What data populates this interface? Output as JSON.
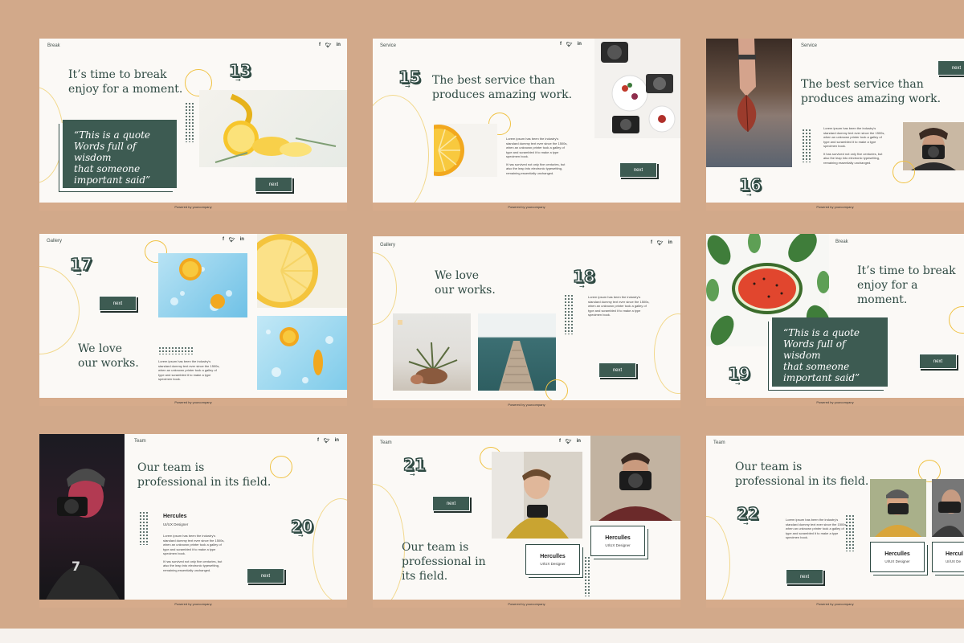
{
  "footer": "Powered by yourcompany",
  "social": [
    "f",
    "t",
    "in"
  ],
  "next": "next",
  "lorem1": [
    "Lorem ipsum has been the industry's",
    "standard dummy text ever since the 1500s,",
    "when an unknown printer took a galley of",
    "type and scrambled it to make a type",
    "specimen book."
  ],
  "lorem2": [
    "It has survived not only five centuries, but",
    "also the leap into electronic typesetting,",
    "remaining essentially unchanged."
  ],
  "s13": {
    "section": "Break",
    "number": "13",
    "head": [
      "It’s time to break",
      "enjoy for a moment."
    ],
    "quote": [
      "“This is a quote",
      "Words full of wisdom",
      "that someone",
      "important said”"
    ]
  },
  "s15": {
    "section": "Service",
    "number": "15",
    "head": [
      "The best service than",
      "produces amazing work."
    ]
  },
  "s16": {
    "section": "Service",
    "number": "16",
    "head": [
      "The best service than",
      "produces amazing work."
    ]
  },
  "s17": {
    "section": "Gallery",
    "number": "17",
    "head": [
      "We love",
      "our works."
    ]
  },
  "s18": {
    "section": "Gallery",
    "number": "18",
    "head": [
      "We love",
      "our works."
    ]
  },
  "s19": {
    "section": "Break",
    "number": "19",
    "head": [
      "It’s time to break",
      "enjoy for a moment."
    ],
    "quote": [
      "“This is a quote",
      "Words full of wisdom",
      "that someone",
      "important said”"
    ]
  },
  "s20": {
    "section": "Team",
    "number": "20",
    "head": [
      "Our team is",
      "professional in its field."
    ],
    "name": "Hercules",
    "role": "UI/UX Designer"
  },
  "s21": {
    "section": "Team",
    "number": "21",
    "head": [
      "Our team is",
      "professional in",
      "its field."
    ],
    "card1": {
      "name": "Herculles",
      "role": "UI/UX Designer"
    },
    "card2": {
      "name": "Herculles",
      "role": "UI/UX Designer"
    }
  },
  "s22": {
    "section": "Team",
    "number": "22",
    "head": [
      "Our team is",
      "professional in its field."
    ],
    "card1": {
      "name": "Herculles",
      "role": "UI/UX Designer"
    },
    "card2": {
      "name": "Hercul",
      "role": "UI/UX De"
    }
  },
  "colors": {
    "background": "#d2a98a",
    "slide": "#fbf9f6",
    "accent": "#3d5b52",
    "footer": "#d6ab8b",
    "ring": "#f0c243"
  }
}
